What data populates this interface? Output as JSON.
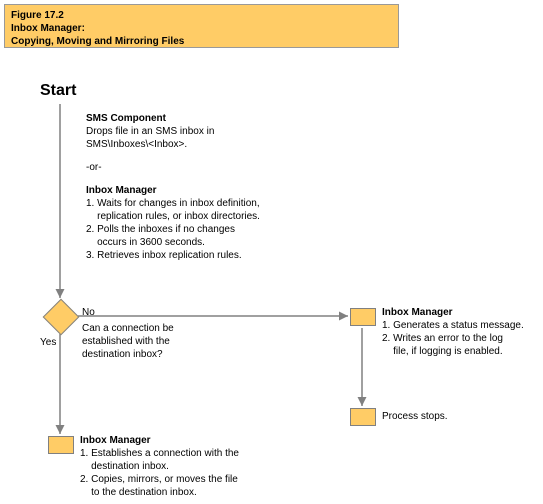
{
  "header": {
    "fig_num": "Figure 17.2",
    "title": "Inbox Manager:",
    "subtitle": "Copying, Moving and Mirroring Files"
  },
  "start_label": "Start",
  "step1": {
    "heading_a": "SMS Component",
    "line_a1": "Drops file in an SMS inbox in",
    "line_a2": "SMS\\Inboxes\\<Inbox>.",
    "or": "-or-",
    "heading_b": "Inbox Manager",
    "line_b1": "1. Waits for changes in inbox definition,",
    "line_b1b": "    replication rules, or inbox directories.",
    "line_b2": "2. Polls the inboxes if no changes",
    "line_b2b": "    occurs in 3600 seconds.",
    "line_b3": "3. Retrieves inbox replication rules."
  },
  "decision": {
    "no_label": "No",
    "yes_label": "Yes",
    "q1": "Can a connection be",
    "q2": "established with the",
    "q3": "destination inbox?"
  },
  "no_branch": {
    "heading": "Inbox Manager",
    "l1": "1. Generates a status message.",
    "l2": "2. Writes an error to the log",
    "l2b": "    file, if logging is enabled."
  },
  "process_stops": "Process stops.",
  "yes_branch": {
    "heading": "Inbox Manager",
    "l1": "1. Establishes a connection with the",
    "l1b": "    destination inbox.",
    "l2": "2. Copies, mirrors, or moves the file",
    "l2b": "    to the destination inbox."
  }
}
